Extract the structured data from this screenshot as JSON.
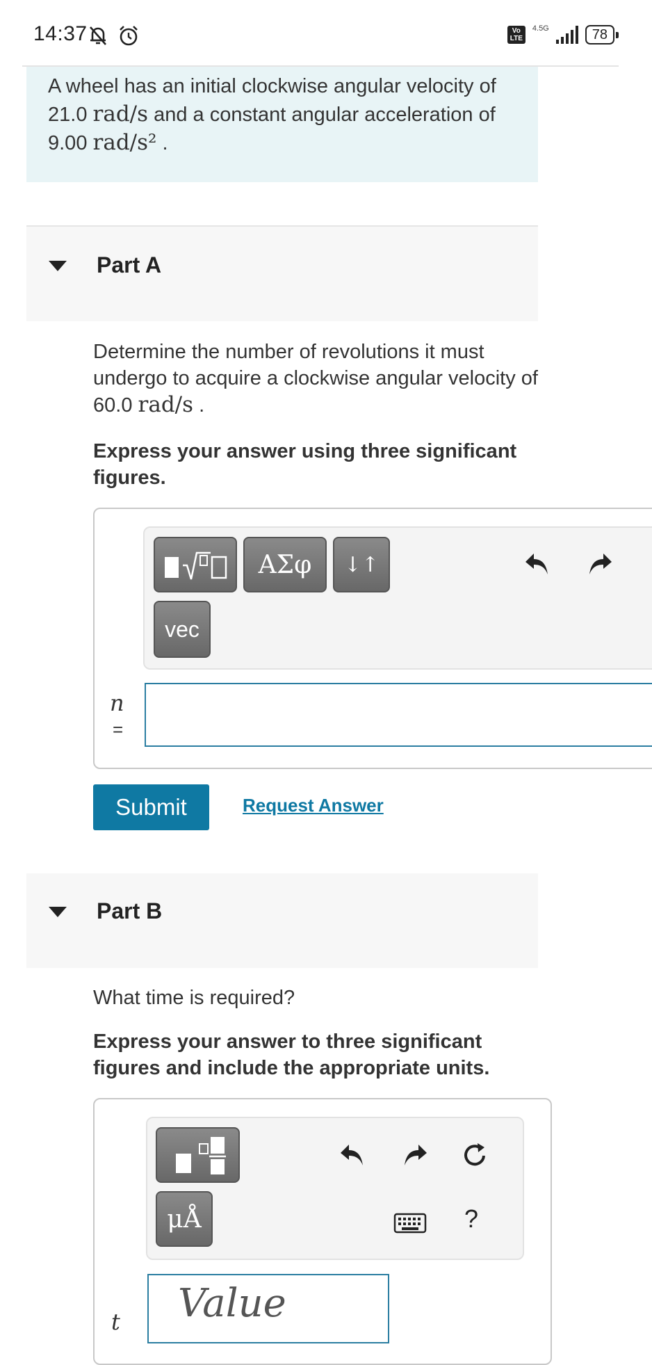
{
  "status_bar": {
    "time": "14:37",
    "volte": "Vo\nLTE",
    "network": "4.5G",
    "battery": "78"
  },
  "intro": {
    "text_1": "A wheel has an initial clockwise angular velocity of 21.0",
    "unit_1": "rad/s",
    "text_2": "and a constant angular acceleration of 9.00",
    "unit_2": "rad/s²",
    "text_3": "."
  },
  "part_a": {
    "title": "Part A",
    "question_1": "Determine the number of revolutions it must undergo to acquire a clockwise angular velocity of 60.0",
    "question_unit": "rad/s",
    "question_end": ".",
    "instruction": "Express your answer using three significant figures.",
    "toolbar": {
      "templates": "▮√▯",
      "greek": "ΑΣφ",
      "arrows": "↓↑",
      "vec": "vec"
    },
    "variable": "n",
    "equals": "=",
    "input_value": ""
  },
  "actions": {
    "submit": "Submit",
    "request_answer": "Request Answer"
  },
  "part_b": {
    "title": "Part B",
    "question": "What time is required?",
    "instruction": "Express your answer to three significant figures and include the appropriate units.",
    "toolbar": {
      "units": "μÅ",
      "help": "?"
    },
    "variable": "t",
    "value_placeholder": "Value"
  },
  "colors": {
    "accent": "#0f79a3",
    "intro_bg": "#e8f4f6",
    "part_bg": "#f7f7f7"
  }
}
